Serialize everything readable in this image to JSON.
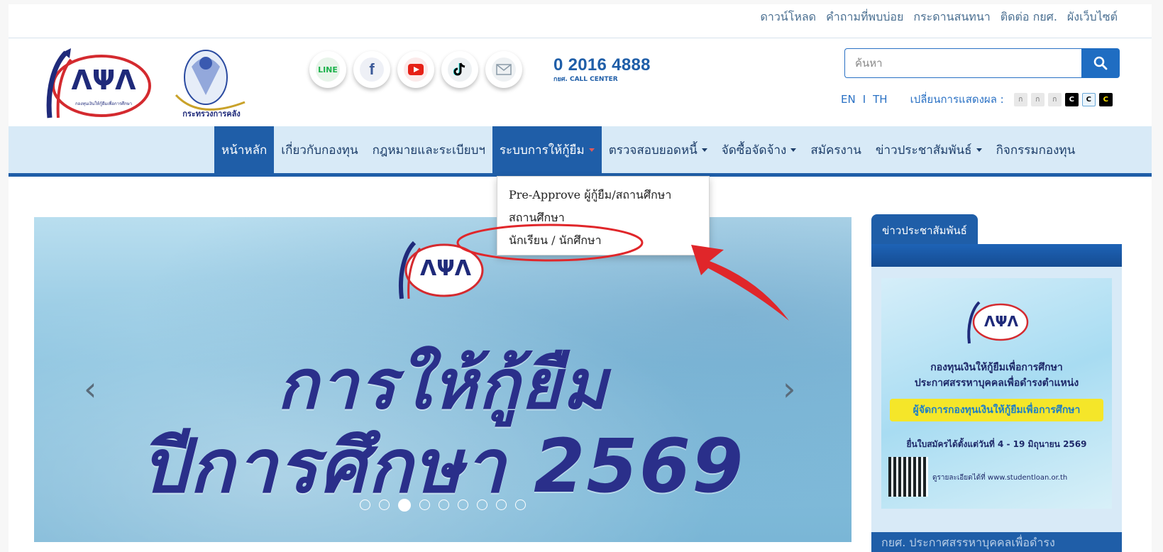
{
  "top_links": [
    "ดาวน์โหลด",
    "คำถามที่พบบ่อย",
    "กระดานสนทนา",
    "ติดต่อ กยศ.",
    "ผังเว็บไซต์"
  ],
  "social": {
    "line_label": "LINE",
    "facebook_label": "f",
    "icons": [
      "line-icon",
      "facebook-icon",
      "youtube-icon",
      "tiktok-icon",
      "mail-icon"
    ]
  },
  "call_center": {
    "number": "0 2016 4888",
    "label": "กยศ. CALL CENTER"
  },
  "search": {
    "placeholder": "ค้นหา"
  },
  "language": {
    "en": "EN",
    "th": "TH",
    "display_label": "เปลี่ยนการแสดงผล :"
  },
  "font_size_options": [
    "ก",
    "ก",
    "ก"
  ],
  "contrast_options": [
    "C",
    "C",
    "C"
  ],
  "nav": {
    "items": [
      "หน้าหลัก",
      "เกี่ยวกับกองทุน",
      "กฎหมายและระเบียบฯ",
      "ระบบการให้กู้ยืม",
      "ตรวจสอบยอดหนี้",
      "จัดซื้อจัดจ้าง",
      "สมัครงาน",
      "ข่าวประชาสัมพันธ์",
      "กิจกรรมกองทุน"
    ],
    "active_index": 0,
    "open_index": 3
  },
  "dropdown": {
    "items": [
      "Pre-Approve ผู้กู้ยืม/สถานศึกษา",
      "สถานศึกษา",
      "นักเรียน / นักศึกษา"
    ]
  },
  "banner": {
    "line1": "การให้กู้ยืม",
    "line2": "ปีการศึกษา 2569",
    "prev": "‹",
    "next": "›",
    "slide_count": 9,
    "active_slide": 2
  },
  "news": {
    "tab_label": "ข่าวประชาสัมพันธ์",
    "poster_line1": "กองทุนเงินให้กู้ยืมเพื่อการศึกษา",
    "poster_line2": "ประกาศสรรหาบุคคลเพื่อดำรงตำแหน่ง",
    "poster_highlight": "ผู้จัดการกองทุนเงินให้กู้ยืมเพื่อการศึกษา",
    "poster_line3": "ยื่นใบสมัครได้ตั้งแต่วันที่ 4 - 19 มิถุนายน 2569",
    "poster_link": "ดูรายละเอียดได้ที่ www.studentloan.or.th",
    "caption": "กยศ. ประกาศสรรหาบุคคลเพื่อดำรง"
  },
  "colors": {
    "primary": "#1f5ea8",
    "nav_bg": "#d8eaf7",
    "annotation": "#e0262a",
    "banner_text": "#2a2f8a"
  }
}
